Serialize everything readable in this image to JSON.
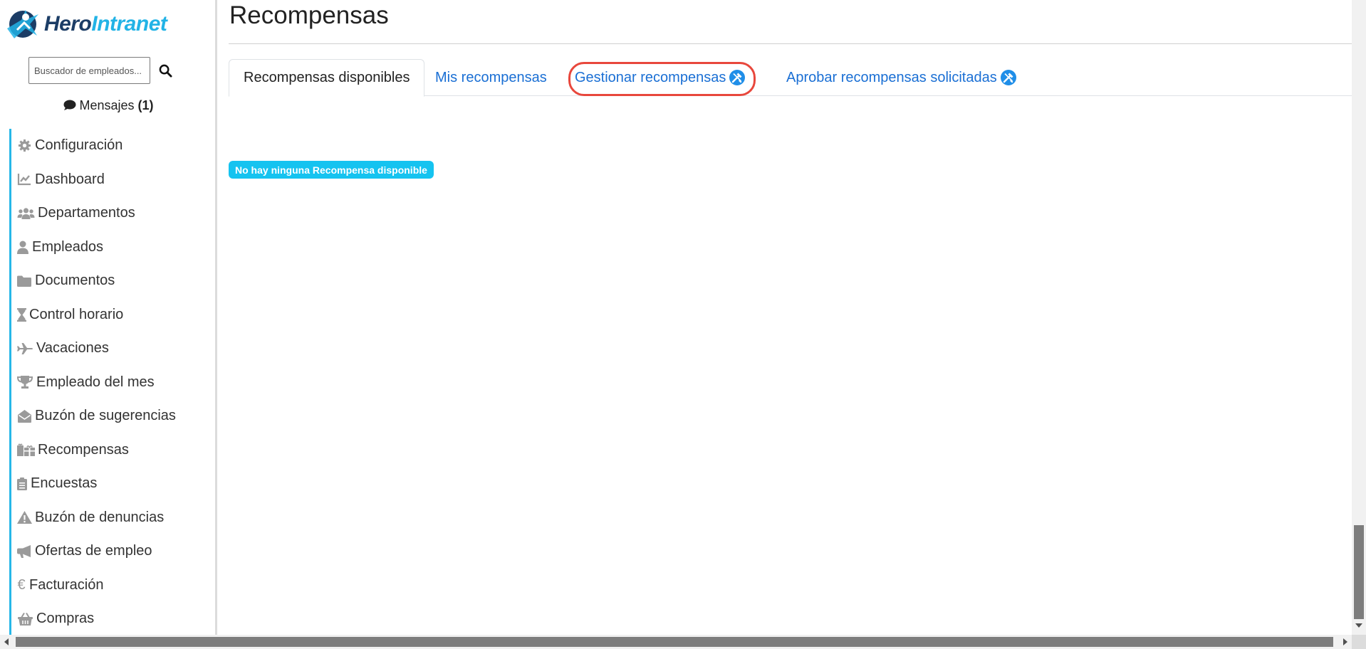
{
  "logo": {
    "part1": "Hero",
    "part2": "Intranet"
  },
  "search": {
    "placeholder": "Buscador de empleados..."
  },
  "messages": {
    "label": "Mensajes",
    "count": "(1)"
  },
  "sidebar": {
    "items": [
      {
        "label": "Configuración",
        "icon": "gear-icon"
      },
      {
        "label": "Dashboard",
        "icon": "chart-line-icon"
      },
      {
        "label": "Departamentos",
        "icon": "users-icon"
      },
      {
        "label": "Empleados",
        "icon": "user-icon"
      },
      {
        "label": "Documentos",
        "icon": "folder-icon"
      },
      {
        "label": "Control horario",
        "icon": "hourglass-icon"
      },
      {
        "label": "Vacaciones",
        "icon": "plane-icon"
      },
      {
        "label": "Empleado del mes",
        "icon": "trophy-icon"
      },
      {
        "label": "Buzón de sugerencias",
        "icon": "envelope-open-icon"
      },
      {
        "label": "Recompensas",
        "icon": "gifts-icon"
      },
      {
        "label": "Encuestas",
        "icon": "clipboard-icon"
      },
      {
        "label": "Buzón de denuncias",
        "icon": "warning-icon"
      },
      {
        "label": "Ofertas de empleo",
        "icon": "megaphone-icon"
      },
      {
        "label": "Facturación",
        "icon": "euro-icon"
      },
      {
        "label": "Compras",
        "icon": "basket-icon"
      }
    ]
  },
  "main": {
    "title": "Recompensas",
    "tabs": [
      {
        "label": "Recompensas disponibles",
        "active": true
      },
      {
        "label": "Mis recompensas",
        "active": false
      },
      {
        "label": "Gestionar recompensas",
        "active": false,
        "badge": "admin-tools-icon"
      },
      {
        "label": "Aprobar recompensas solicitadas",
        "active": false,
        "badge": "admin-tools-icon"
      }
    ],
    "empty_message": "No hay ninguna Recompensa disponible"
  },
  "colors": {
    "accent": "#26b7e8",
    "link": "#1a6fd4",
    "highlight": "#e8473c",
    "badge": "#15c3f0",
    "logo_dark": "#1c3d66"
  }
}
